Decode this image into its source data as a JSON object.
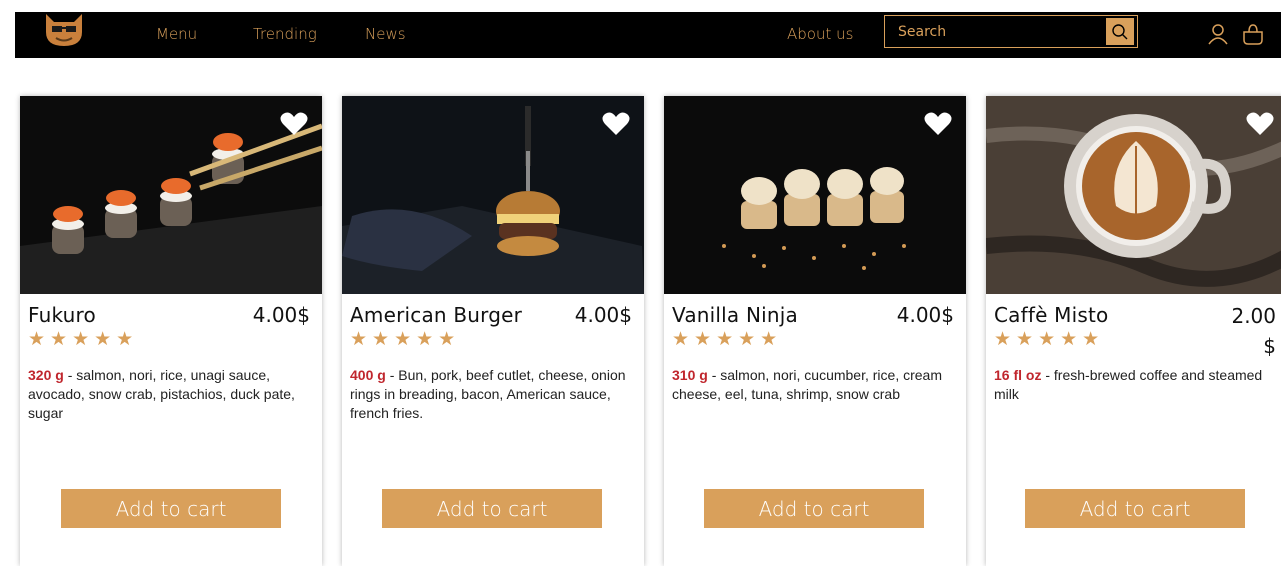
{
  "nav": {
    "logo": "cat-logo",
    "links": [
      "Menu",
      "Trending",
      "News",
      "About us"
    ],
    "search_placeholder": "Search",
    "icons": [
      "search-icon",
      "user-icon",
      "bag-icon"
    ]
  },
  "theme": {
    "accent": "#d9a05b",
    "weight_color": "#c0262d",
    "nav_bg": "#000000"
  },
  "products": [
    {
      "name": "Fukuro",
      "price": "4.00$",
      "rating": 5,
      "stars": "★★★★★",
      "weight": "320 g",
      "description": " - salmon, nori, rice, unagi sauce, avocado, snow crab, pistachios, duck pate, sugar",
      "button": "Add to cart"
    },
    {
      "name": "American Burger",
      "price": "4.00$",
      "rating": 5,
      "stars": "★★★★★",
      "weight": "400 g",
      "description": " - Bun, pork, beef cutlet, cheese, onion rings in breading, bacon, American sauce, french fries.",
      "button": "Add to cart"
    },
    {
      "name": "Vanilla Ninja",
      "price": "4.00$",
      "rating": 5,
      "stars": "★★★★★",
      "weight": "310 g",
      "description": " - salmon, nori, cucumber, rice, cream cheese, eel, tuna, shrimp, snow crab",
      "button": "Add to cart"
    },
    {
      "name": "Caffè Misto",
      "price": "2.00 $",
      "rating": 5,
      "stars": "★★★★★",
      "weight": "16 fl oz",
      "description": " - fresh-brewed coffee and steamed milk",
      "button": "Add to cart"
    }
  ]
}
